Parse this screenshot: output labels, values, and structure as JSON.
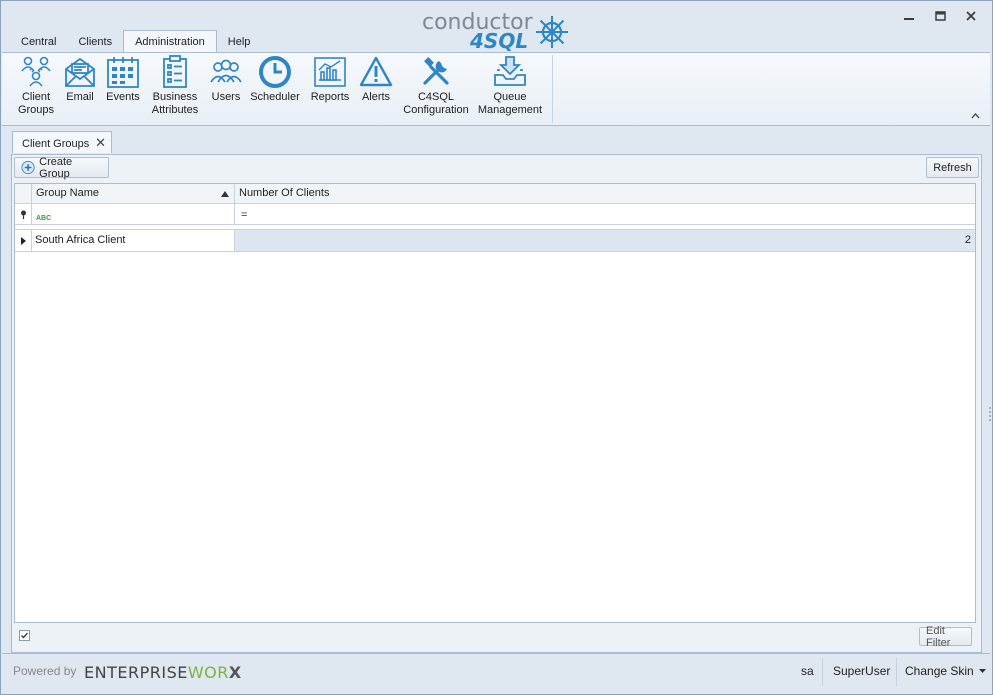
{
  "app": {
    "logo_line1": "conductor",
    "logo_line2": "4SQL"
  },
  "window_controls": {
    "minimize": "minimize-icon",
    "restore": "restore-icon",
    "close": "close-icon"
  },
  "tabs": [
    {
      "label": "Central"
    },
    {
      "label": "Clients"
    },
    {
      "label": "Administration",
      "active": true
    },
    {
      "label": "Help"
    }
  ],
  "ribbon": {
    "buttons": [
      {
        "label1": "Client",
        "label2": "Groups",
        "icon": "client-groups-icon"
      },
      {
        "label1": "Email",
        "label2": "",
        "icon": "email-icon"
      },
      {
        "label1": "Events",
        "label2": "",
        "icon": "calendar-icon"
      },
      {
        "label1": "Business",
        "label2": "Attributes",
        "icon": "clipboard-list-icon"
      },
      {
        "label1": "Users",
        "label2": "",
        "icon": "users-icon"
      },
      {
        "label1": "Scheduler",
        "label2": "",
        "icon": "clock-icon"
      },
      {
        "label1": "Reports",
        "label2": "",
        "icon": "chart-report-icon"
      },
      {
        "label1": "Alerts",
        "label2": "",
        "icon": "warning-icon"
      },
      {
        "label1": "C4SQL",
        "label2": "Configuration",
        "icon": "tools-icon"
      },
      {
        "label1": "Queue",
        "label2": "Management",
        "icon": "inbox-tray-icon"
      }
    ]
  },
  "document_tab": {
    "label": "Client Groups",
    "close_glyph": "✕"
  },
  "toolbar": {
    "create_label": "Create Group",
    "refresh_label": "Refresh"
  },
  "grid": {
    "columns": [
      "Group Name",
      "Number Of Clients"
    ],
    "filter": {
      "text_mode": "ABC",
      "number_mode": "="
    },
    "rows": [
      {
        "name": "South Africa Client",
        "count": "2"
      }
    ],
    "edit_filter_label": "Edit Filter"
  },
  "statusbar": {
    "powered_by": "Powered by",
    "brand_part1": "ENTERPRISE",
    "brand_part2": "WOR",
    "brand_part3": "X",
    "user": "sa",
    "role": "SuperUser",
    "skin_label": "Change Skin"
  },
  "colors": {
    "accent": "#2f86c7",
    "brand_green": "#7cb342",
    "frame": "#dfe8f1"
  }
}
